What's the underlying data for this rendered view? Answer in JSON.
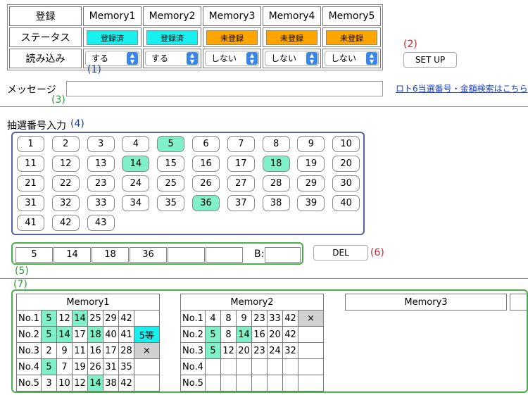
{
  "memory": {
    "row_labels": [
      "登録",
      "ステータス",
      "読み込み"
    ],
    "columns": [
      {
        "name": "Memory1",
        "status": "登録済",
        "status_color": "#18f0f0",
        "load": "する"
      },
      {
        "name": "Memory2",
        "status": "登録済",
        "status_color": "#18f0f0",
        "load": "する"
      },
      {
        "name": "Memory3",
        "status": "未登録",
        "status_color": "#ffa500",
        "load": "しない"
      },
      {
        "name": "Memory4",
        "status": "未登録",
        "status_color": "#ffa500",
        "load": "しない"
      },
      {
        "name": "Memory5",
        "status": "未登録",
        "status_color": "#ffa500",
        "load": "しない"
      }
    ]
  },
  "annotations": {
    "a1": "(1)",
    "a2": "(2)",
    "a3": "(3)",
    "a4": "(4)",
    "a5": "(5)",
    "a6": "(6)",
    "a7": "(7)"
  },
  "setup_label": "SET UP",
  "message": {
    "label": "メッセージ",
    "value": ""
  },
  "link_text": "ロト6当選番号・金額検索はこちら",
  "draw_input": {
    "title": "抽選番号入力",
    "numbers": [
      1,
      2,
      3,
      4,
      5,
      6,
      7,
      8,
      9,
      10,
      11,
      12,
      13,
      14,
      15,
      16,
      17,
      18,
      19,
      20,
      21,
      22,
      23,
      24,
      25,
      26,
      27,
      28,
      29,
      30,
      31,
      32,
      33,
      34,
      35,
      36,
      37,
      38,
      39,
      40,
      41,
      42,
      43
    ],
    "selected": [
      5,
      14,
      18,
      36
    ]
  },
  "picked": {
    "slots": [
      "5",
      "14",
      "18",
      "36",
      "",
      ""
    ],
    "bonus_label": "B:",
    "bonus_value": ""
  },
  "del_label": "DEL",
  "results": [
    {
      "name": "Memory1",
      "rows": [
        {
          "label": "No.1",
          "nums": [
            "5",
            "12",
            "14",
            "25",
            "29",
            "42"
          ],
          "result": ""
        },
        {
          "label": "No.2",
          "nums": [
            "5",
            "14",
            "17",
            "18",
            "40",
            "41"
          ],
          "result": "5等"
        },
        {
          "label": "No.3",
          "nums": [
            "2",
            "9",
            "11",
            "16",
            "17",
            "28"
          ],
          "result": "×"
        },
        {
          "label": "No.4",
          "nums": [
            "5",
            "7",
            "19",
            "26",
            "31",
            "35"
          ],
          "result": ""
        },
        {
          "label": "No.5",
          "nums": [
            "3",
            "10",
            "12",
            "14",
            "38",
            "42"
          ],
          "result": ""
        }
      ]
    },
    {
      "name": "Memory2",
      "rows": [
        {
          "label": "No.1",
          "nums": [
            "4",
            "8",
            "9",
            "23",
            "33",
            "42"
          ],
          "result": "×"
        },
        {
          "label": "No.2",
          "nums": [
            "5",
            "8",
            "14",
            "16",
            "20",
            "42"
          ],
          "result": ""
        },
        {
          "label": "No.3",
          "nums": [
            "5",
            "12",
            "20",
            "23",
            "24",
            "32"
          ],
          "result": ""
        },
        {
          "label": "No.4",
          "nums": [
            "",
            "",
            "",
            "",
            "",
            ""
          ],
          "result": ""
        },
        {
          "label": "No.5",
          "nums": [
            "",
            "",
            "",
            "",
            "",
            ""
          ],
          "result": ""
        }
      ]
    },
    {
      "name": "Memory3",
      "rows": []
    }
  ]
}
